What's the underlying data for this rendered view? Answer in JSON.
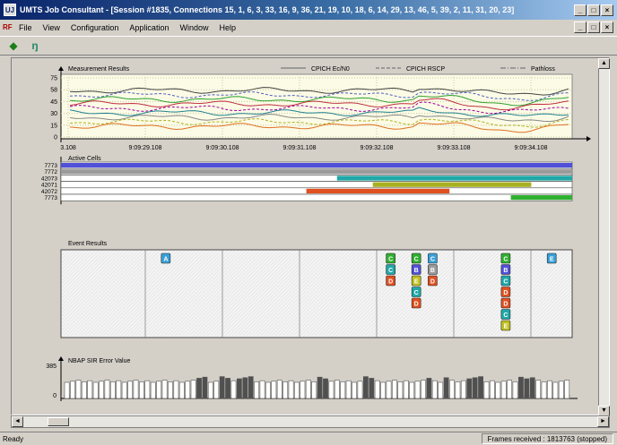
{
  "window": {
    "title": "UMTS Job Consultant - [Session #1835, Connections 15, 1, 6, 3, 33, 16, 9, 36, 21, 19, 10, 18, 6, 14, 29, 13, 46, 5, 39, 2, 11, 31, 20, 23]",
    "app_icon_label": "UJ",
    "minimize": "_",
    "maximize": "□",
    "close": "×"
  },
  "menubar": {
    "doc_icon": "RF",
    "items": [
      "File",
      "View",
      "Configuration",
      "Application",
      "Window",
      "Help"
    ]
  },
  "toolbar": {
    "tools": [
      {
        "name": "back-arrow-icon",
        "glyph": "◆"
      },
      {
        "name": "antenna-icon",
        "glyph": "ŋ"
      }
    ]
  },
  "measurement_panel": {
    "title": "Measurement Results",
    "legend": [
      {
        "label": "CPICH Ec/N0",
        "style": "solid",
        "color": "#7a7a7a"
      },
      {
        "label": "CPICH RSCP",
        "style": "dashed",
        "color": "#7a7a7a"
      },
      {
        "label": "Pathloss",
        "style": "dashdot",
        "color": "#7a7a7a"
      }
    ],
    "y_ticks": [
      "75",
      "58",
      "45",
      "30",
      "15",
      "0"
    ],
    "x_ticks": [
      "3.108",
      "9:09:29.108",
      "9:09:30.108",
      "9:09:31.108",
      "9:09:32.108",
      "9:09:33.108",
      "9:09:34.108"
    ]
  },
  "active_cells_panel": {
    "title": "Active Cells",
    "cells": [
      {
        "label": "7773",
        "color": "#5050d8",
        "start": 0.0,
        "end": 1.0
      },
      {
        "label": "7772",
        "color": "#9a9a9a",
        "start": 0.0,
        "end": 1.0
      },
      {
        "label": "42073",
        "color": "#20a8a8",
        "start": 0.54,
        "end": 1.0
      },
      {
        "label": "42071",
        "color": "#a8b020",
        "start": 0.61,
        "end": 0.92
      },
      {
        "label": "42072",
        "color": "#e05020",
        "start": 0.48,
        "end": 0.76
      },
      {
        "label": "7773",
        "color": "#30b030",
        "start": 0.88,
        "end": 1.0
      }
    ]
  },
  "event_panel": {
    "title": "Event Results",
    "columns": [
      {
        "pos": 0.205,
        "events": [
          {
            "t": "A",
            "c": "#3aa0d8"
          }
        ]
      },
      {
        "pos": 0.645,
        "events": [
          {
            "t": "C",
            "c": "#30b030"
          },
          {
            "t": "C",
            "c": "#20a8a8"
          },
          {
            "t": "D",
            "c": "#e05020"
          }
        ]
      },
      {
        "pos": 0.695,
        "events": [
          {
            "t": "C",
            "c": "#30b030"
          },
          {
            "t": "B",
            "c": "#5050d8"
          },
          {
            "t": "E",
            "c": "#c0c020"
          },
          {
            "t": "C",
            "c": "#20a8a8"
          },
          {
            "t": "D",
            "c": "#e05020"
          }
        ]
      },
      {
        "pos": 0.727,
        "events": [
          {
            "t": "C",
            "c": "#3aa0d8"
          },
          {
            "t": "B",
            "c": "#9a9a9a"
          },
          {
            "t": "D",
            "c": "#e05020"
          }
        ]
      },
      {
        "pos": 0.87,
        "events": [
          {
            "t": "C",
            "c": "#30b030"
          },
          {
            "t": "B",
            "c": "#5050d8"
          },
          {
            "t": "C",
            "c": "#20a8a8"
          },
          {
            "t": "D",
            "c": "#e05020"
          },
          {
            "t": "D",
            "c": "#e05020"
          },
          {
            "t": "C",
            "c": "#20a8a8"
          },
          {
            "t": "E",
            "c": "#c0c020"
          }
        ]
      },
      {
        "pos": 0.96,
        "events": [
          {
            "t": "E",
            "c": "#3aa0d8"
          }
        ]
      }
    ]
  },
  "sir_panel": {
    "title": "NBAP SIR Error Value",
    "y_ticks": [
      "385",
      "0"
    ]
  },
  "status": {
    "left": "Ready",
    "right": "Frames received : 1813763 (stopped)"
  }
}
